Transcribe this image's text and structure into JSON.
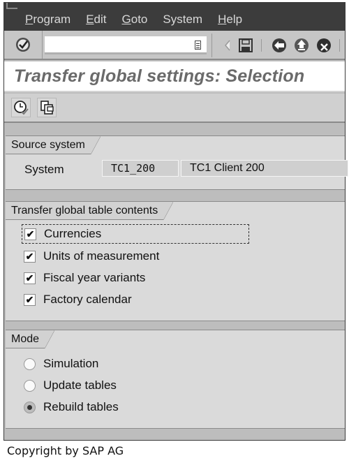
{
  "menubar": {
    "items": [
      {
        "first": "P",
        "rest": "rogram"
      },
      {
        "first": "E",
        "rest": "dit"
      },
      {
        "first": "G",
        "rest": "oto"
      },
      {
        "first": "",
        "rest": "System"
      },
      {
        "first": "H",
        "rest": "elp"
      }
    ]
  },
  "toolbar": {
    "command_field_value": "",
    "icons": [
      "enter-icon",
      "back-arrow-icon",
      "save-icon",
      "back-icon",
      "exit-icon",
      "cancel-icon"
    ]
  },
  "page": {
    "title": "Transfer global settings: Selection"
  },
  "app_toolbar": {
    "icons": [
      "execute-in-background-icon",
      "copy-icon"
    ]
  },
  "source_system": {
    "heading": "Source system",
    "label": "System",
    "system_id": "TC1_200",
    "description": "TC1 Client 200"
  },
  "transfer_contents": {
    "heading": "Transfer global table contents",
    "items": [
      {
        "label": "Currencies",
        "checked": true
      },
      {
        "label": "Units of measurement",
        "checked": true
      },
      {
        "label": "Fiscal year variants",
        "checked": true
      },
      {
        "label": "Factory calendar",
        "checked": true
      }
    ]
  },
  "mode": {
    "heading": "Mode",
    "options": [
      {
        "label": "Simulation",
        "selected": false
      },
      {
        "label": "Update tables",
        "selected": false
      },
      {
        "label": "Rebuild tables",
        "selected": true
      }
    ]
  },
  "footer": {
    "copyright": "Copyright by SAP AG"
  }
}
